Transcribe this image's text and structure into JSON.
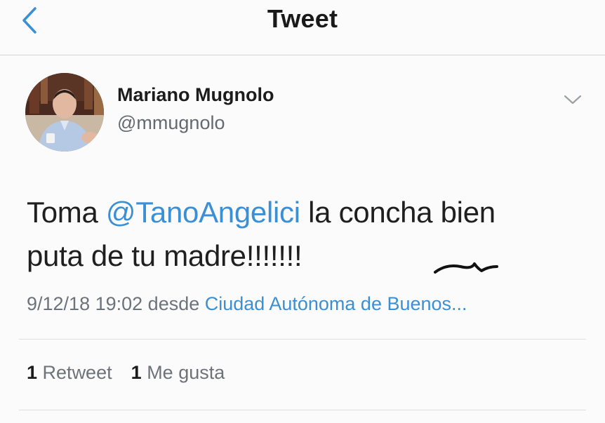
{
  "nav": {
    "title": "Tweet",
    "back_icon": "chevron-left-icon",
    "accent_color": "#3b8fd4"
  },
  "tweet": {
    "author": {
      "display_name": "Mariano Mugnolo",
      "handle": "@mmugnolo",
      "avatar_icon": "profile-photo"
    },
    "menu_icon": "chevron-down-icon",
    "text_before": "Toma ",
    "mention": "@TanoAngelici",
    "text_after_line1": " la concha bien",
    "text_line2": "puta de tu madre!!!!!!!",
    "timestamp": "9/12/18 19:02",
    "desde": "desde",
    "location": "Ciudad Autónoma de Buenos..."
  },
  "stats": {
    "retweet_count": "1",
    "retweet_label": "Retweet",
    "like_count": "1",
    "like_label": "Me gusta"
  }
}
